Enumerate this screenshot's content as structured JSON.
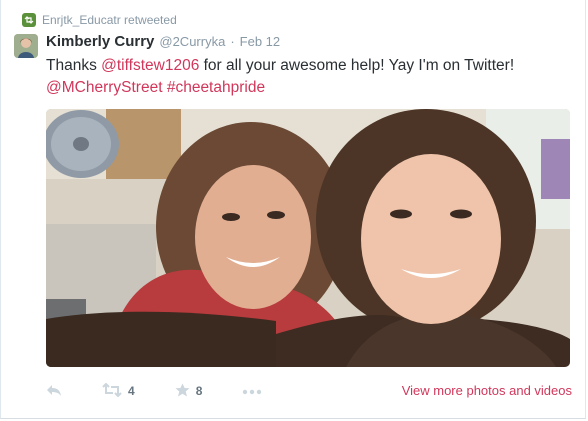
{
  "retweet": {
    "icon": "retweet-icon",
    "text": "Enrjtk_Educatr retweeted"
  },
  "tweet": {
    "name": "Kimberly Curry",
    "handle": "@2Curryka",
    "separator": "·",
    "time": "Feb 12",
    "text_parts": {
      "p1": "Thanks ",
      "mention1": "@tiffstew1206",
      "p2": " for all your awesome help! Yay I'm on Twitter!",
      "mention2": "@MCherryStreet",
      "space": " ",
      "hashtag": "#cheetahpride"
    }
  },
  "actions": {
    "reply_icon": "reply-icon",
    "retweet_icon": "retweet-icon",
    "retweet_count": "4",
    "favorite_icon": "star-icon",
    "favorite_count": "8",
    "more_icon": "more-icon"
  },
  "view_more": "View more photos and videos",
  "colors": {
    "link": "#d0375b",
    "muted": "#8899a6",
    "text": "#292f33",
    "retweet_badge": "#5c913b"
  }
}
